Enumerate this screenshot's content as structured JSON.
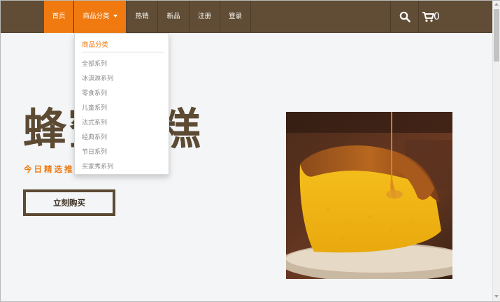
{
  "nav": {
    "items": [
      {
        "label": "首页",
        "state": "active"
      },
      {
        "label": "商品分类",
        "state": "open",
        "dropdown": true
      },
      {
        "label": "热销",
        "state": "normal"
      },
      {
        "label": "新品",
        "state": "normal"
      },
      {
        "label": "注册",
        "state": "normal"
      },
      {
        "label": "登录",
        "state": "normal"
      }
    ],
    "search_icon": "search-icon",
    "cart_icon": "cart-icon",
    "cart_count": "0"
  },
  "dropdown": {
    "header": "商品分类",
    "items": [
      "全部系列",
      "冰淇淋系列",
      "零食系列",
      "儿童系列",
      "法式系列",
      "经典系列",
      "节日系列",
      "买家秀系列"
    ]
  },
  "hero": {
    "title": "蜂蜜蛋糕",
    "subtitle": "今日精选推荐",
    "buy_label": "立刻购买"
  },
  "colors": {
    "nav_bg": "#614d35",
    "accent": "#f07a10",
    "title": "#5c4a33",
    "page_bg": "#f3f5f7"
  }
}
